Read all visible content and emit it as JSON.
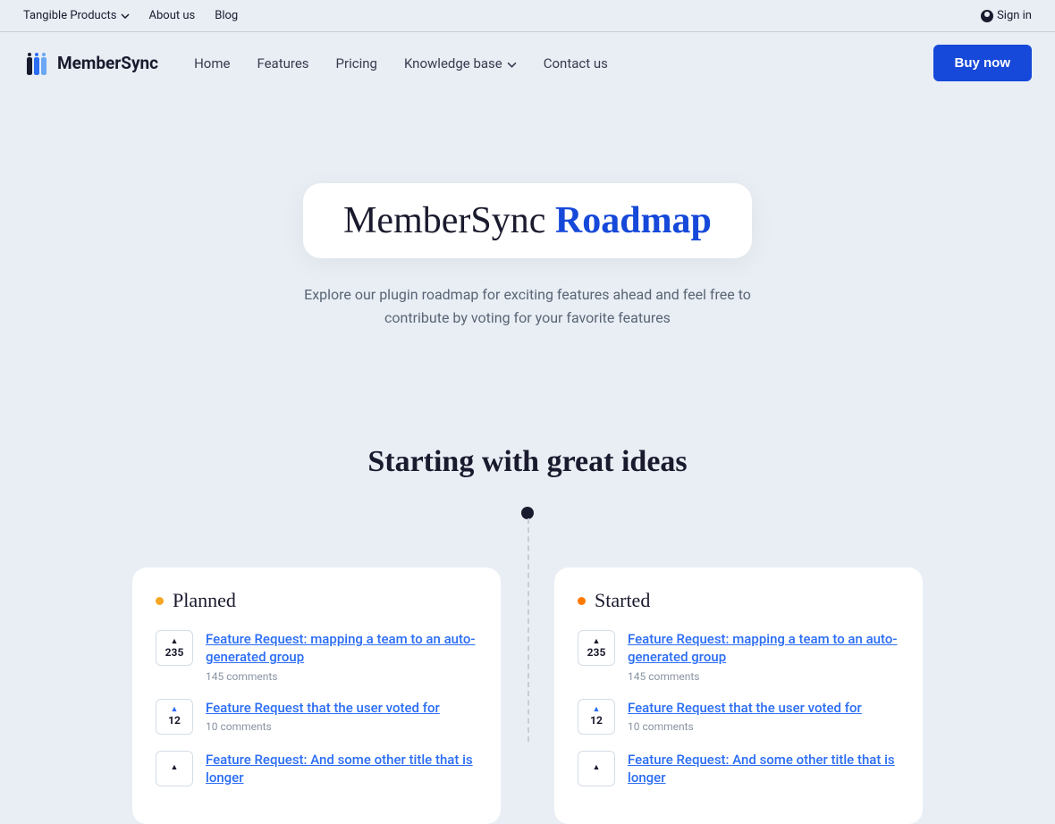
{
  "topbar": {
    "tangible": "Tangible Products",
    "about": "About us",
    "blog": "Blog",
    "signin": "Sign in"
  },
  "nav": {
    "brand": "MemberSync",
    "home": "Home",
    "features": "Features",
    "pricing": "Pricing",
    "knowledge": "Knowledge base",
    "contact": "Contact us",
    "buy": "Buy now"
  },
  "hero": {
    "title_a": "MemberSync ",
    "title_b": "Roadmap",
    "subtitle": "Explore our plugin roadmap for exciting features ahead and feel free to contribute by voting for your favorite features"
  },
  "section": {
    "title": "Starting with great ideas"
  },
  "cards": {
    "planned": {
      "label": "Planned",
      "items": [
        {
          "votes": "235",
          "voted": false,
          "title": "Feature Request: mapping a team to an auto-generated group",
          "comments": "145 comments"
        },
        {
          "votes": "12",
          "voted": true,
          "title": "Feature Request that the user voted for",
          "comments": "10 comments"
        },
        {
          "votes": "",
          "voted": false,
          "title": "Feature Request: And some other title that is longer",
          "comments": ""
        }
      ]
    },
    "started": {
      "label": "Started",
      "items": [
        {
          "votes": "235",
          "voted": false,
          "title": "Feature Request: mapping a team to an auto-generated group",
          "comments": "145 comments"
        },
        {
          "votes": "12",
          "voted": true,
          "title": "Feature Request that the user voted for",
          "comments": "10 comments"
        },
        {
          "votes": "",
          "voted": false,
          "title": "Feature Request: And some other title that is longer",
          "comments": ""
        }
      ]
    }
  }
}
